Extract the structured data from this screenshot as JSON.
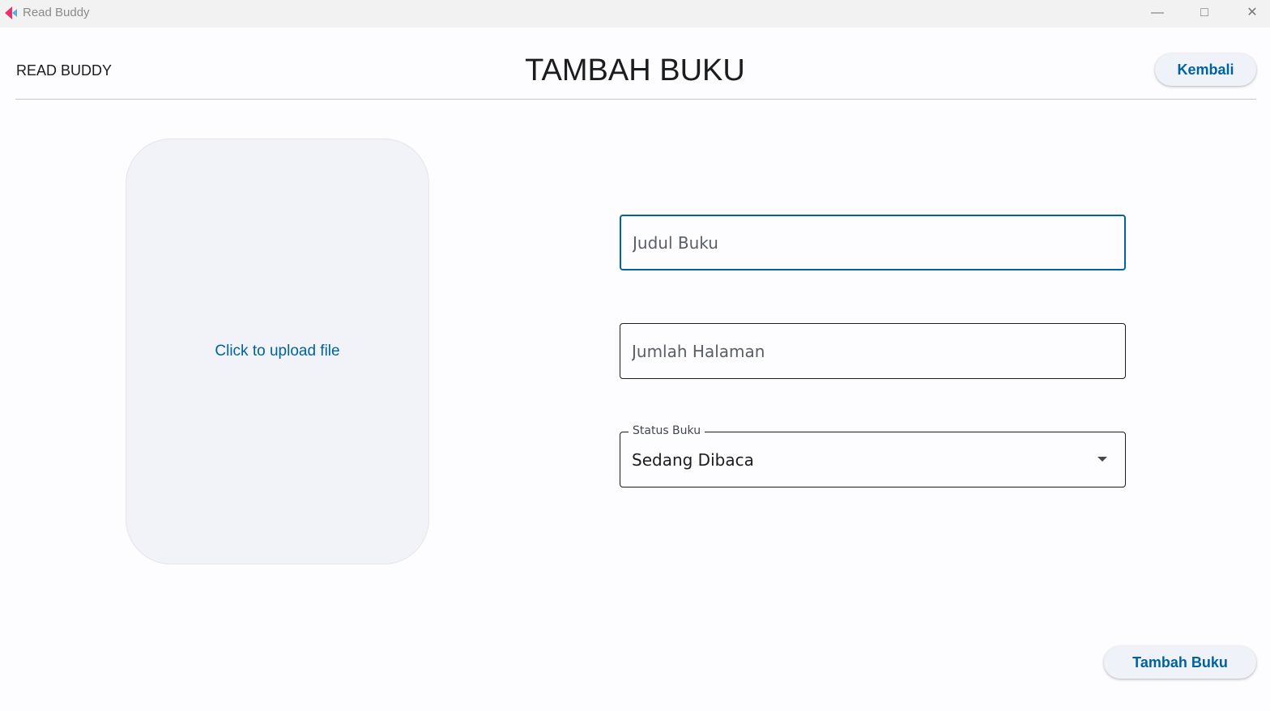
{
  "window": {
    "title": "Read Buddy",
    "minimize_icon": "minimize-icon",
    "maximize_icon": "maximize-icon",
    "close_icon": "close-icon"
  },
  "header": {
    "brand": "READ BUDDY",
    "title": "TAMBAH BUKU",
    "back_label": "Kembali"
  },
  "upload": {
    "label": "Click to upload file"
  },
  "form": {
    "title_placeholder": "Judul Buku",
    "title_value": "",
    "pages_placeholder": "Jumlah Halaman",
    "pages_value": "",
    "status_label": "Status Buku",
    "status_value": "Sedang Dibaca"
  },
  "submit_label": "Tambah Buku",
  "colors": {
    "accent": "#00639b",
    "surface": "#f1f3f9"
  }
}
